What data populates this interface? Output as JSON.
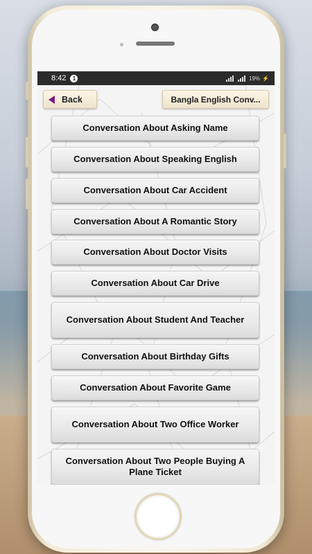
{
  "status_bar": {
    "time": "8:42",
    "notification_count": "1",
    "battery": "19%"
  },
  "header": {
    "back_label": "Back",
    "title": "Bangla English Conv..."
  },
  "conversations": [
    "Conversation About Asking Name",
    "Conversation About Speaking English",
    "Conversation About Car Accident",
    "Conversation About A Romantic Story",
    "Conversation About Doctor Visits",
    "Conversation About Car Drive",
    "Conversation About Student And Teacher",
    "Conversation About Birthday Gifts",
    "Conversation About Favorite Game",
    "Conversation About Two Office Worker",
    "Conversation About Two People Buying A Plane Ticket"
  ],
  "colors": {
    "back_arrow": "#7b1b86",
    "status_bar": "#2b2b2b"
  }
}
